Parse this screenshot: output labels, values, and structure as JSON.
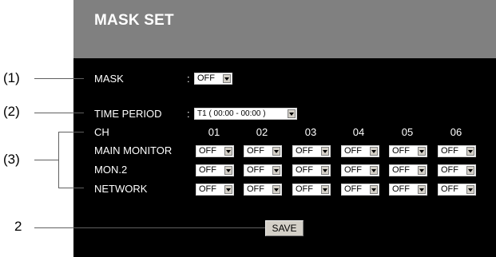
{
  "title": "MASK SET",
  "mask": {
    "label": "MASK",
    "value": "OFF"
  },
  "time_period": {
    "label": "TIME PERIOD",
    "value": "T1 ( 00:00 - 00:00 )"
  },
  "colon": ":",
  "channels": {
    "label": "CH",
    "columns": [
      "01",
      "02",
      "03",
      "04",
      "05",
      "06"
    ],
    "rows": [
      {
        "label": "MAIN MONITOR",
        "values": [
          "OFF",
          "OFF",
          "OFF",
          "OFF",
          "OFF",
          "OFF"
        ]
      },
      {
        "label": "MON.2",
        "values": [
          "OFF",
          "OFF",
          "OFF",
          "OFF",
          "OFF",
          "OFF"
        ]
      },
      {
        "label": "NETWORK",
        "values": [
          "OFF",
          "OFF",
          "OFF",
          "OFF",
          "OFF",
          "OFF"
        ]
      }
    ]
  },
  "save_label": "SAVE",
  "callouts": {
    "c1": "(1)",
    "c2": "(2)",
    "c3": "(3)",
    "c4": "2"
  }
}
